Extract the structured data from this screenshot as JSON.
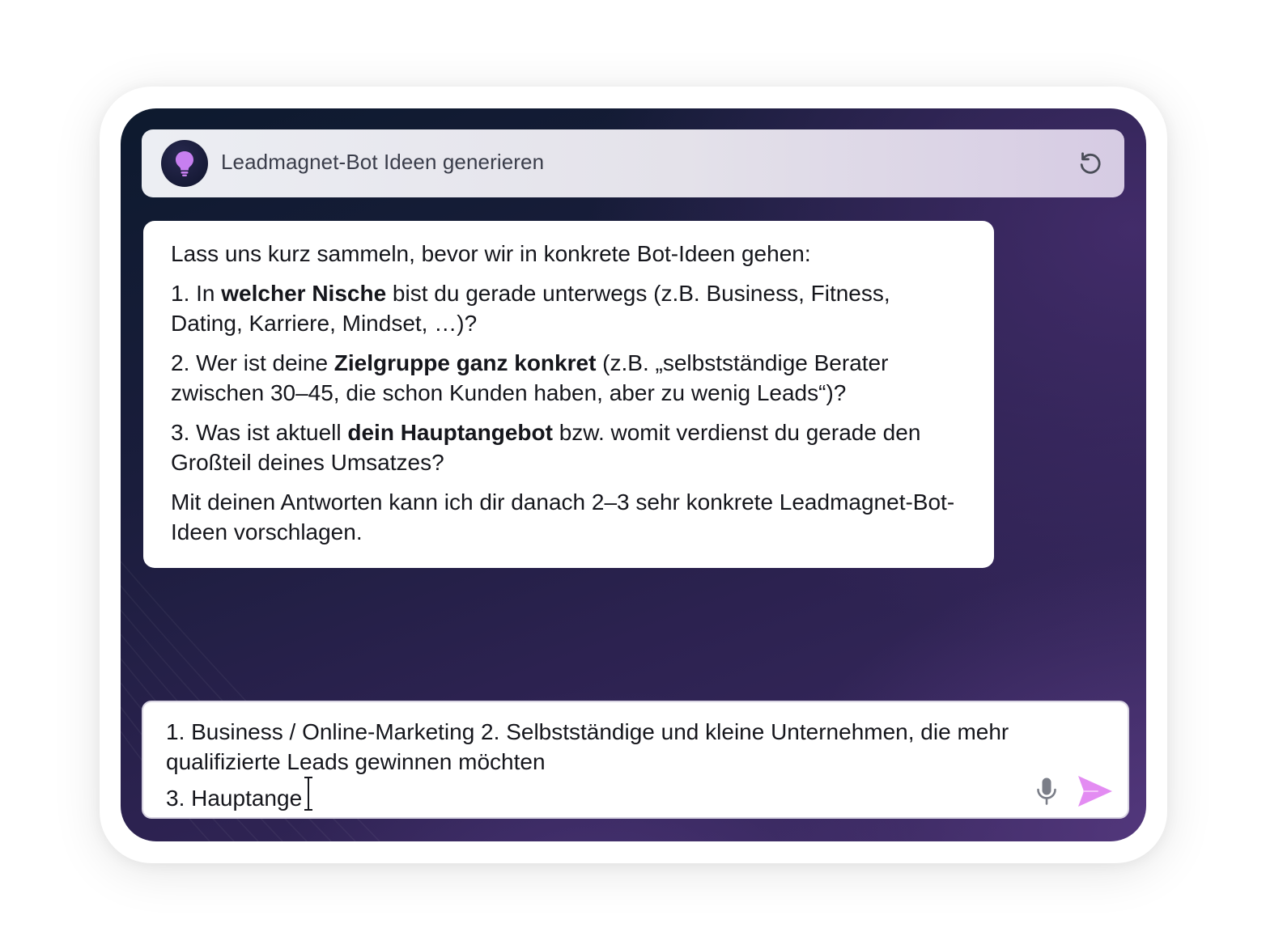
{
  "header": {
    "title": "Leadmagnet-Bot Ideen generieren",
    "avatar_icon": "lightbulb-icon",
    "reset_icon": "refresh-icon",
    "accent_color": "#c77ff0"
  },
  "bot_message": {
    "intro": "Lass uns kurz sammeln, bevor wir in konkrete Bot-Ideen gehen:",
    "q1": {
      "prefix": "1. In ",
      "bold": "welcher Nische",
      "suffix": " bist du gerade unterwegs (z.B. Business, Fitness, Dating, Karriere, Mindset, …)?"
    },
    "q2": {
      "prefix": "2. Wer ist deine ",
      "bold": "Zielgruppe ganz konkret",
      "suffix": " (z.B. „selbstständige Berater zwischen 30–45, die schon Kunden haben, aber zu wenig Leads“)?"
    },
    "q3": {
      "prefix": "3. Was ist aktuell ",
      "bold": "dein Hauptangebot",
      "suffix": " bzw. womit verdienst du gerade den Großteil deines Umsatzes?"
    },
    "outro": "Mit deinen Antworten kann ich dir danach 2–3 sehr konkrete Leadmagnet-Bot-Ideen vorschlagen."
  },
  "composer": {
    "value": "1. Business / Online-Marketing 2. Selbstständige und kleine Unternehmen, die mehr qualifizierte Leads gewinnen möchten\n3. Hauptange",
    "mic_icon": "microphone-icon",
    "send_icon": "send-icon",
    "send_color": "#e38cf2"
  }
}
